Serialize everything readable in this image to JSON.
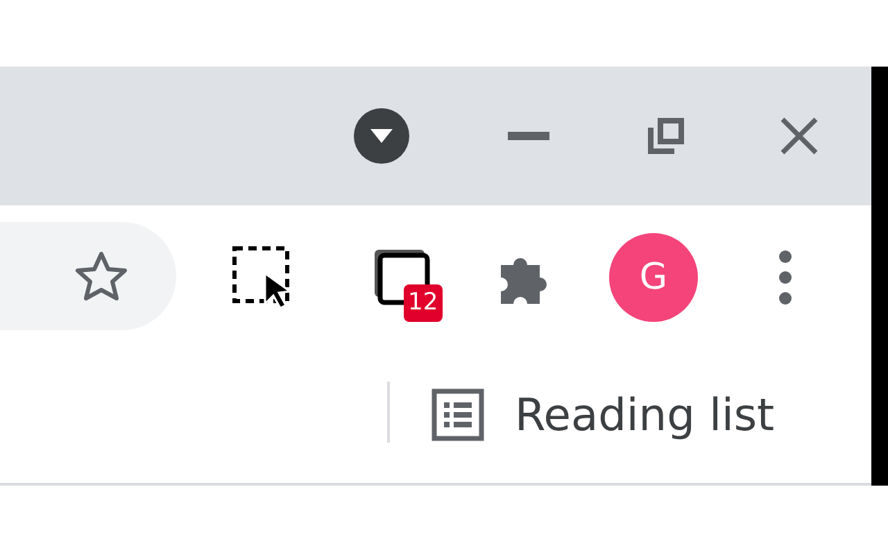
{
  "toolbar": {
    "tab_count_badge": "12",
    "profile_initial": "G"
  },
  "bookmarks_bar": {
    "items": [
      {
        "label": "Reading list"
      }
    ]
  }
}
